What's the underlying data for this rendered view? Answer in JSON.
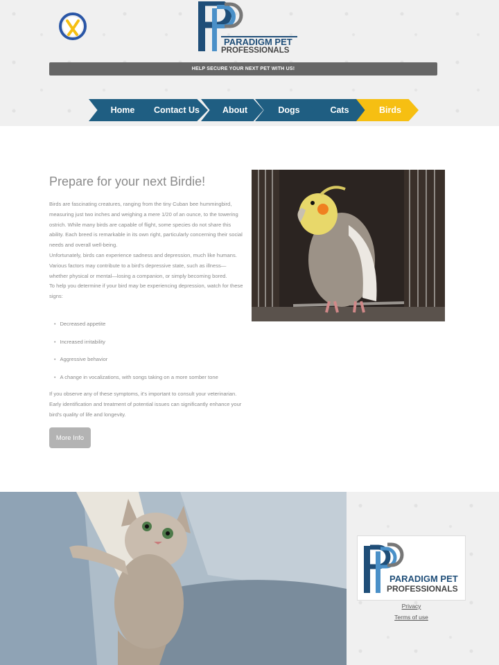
{
  "header": {
    "logo_line1": "PARADIGM PET",
    "logo_line2": "PROFESSIONALS",
    "banner_text": "HELP SECURE YOUR NEXT PET WITH US!",
    "nav": [
      {
        "label": "Home"
      },
      {
        "label": "Contact Us"
      },
      {
        "label": "About"
      },
      {
        "label": "Dogs"
      },
      {
        "label": "Cats"
      },
      {
        "label": "Birds",
        "active": true
      }
    ]
  },
  "main": {
    "heading": "Prepare for your next Birdie!",
    "paragraph1": "Birds are fascinating creatures, ranging from the tiny Cuban bee hummingbird, measuring just two inches and weighing a mere 1/20 of an ounce, to the towering ostrich. While many birds are capable of flight, some species do not share this ability. Each breed is remarkable in its own right, particularly concerning their social needs and overall well-being.",
    "paragraph2": "Unfortunately, birds can experience sadness and depression, much like humans. Various factors may contribute to a bird's depressive state, such as illness—whether physical or mental—losing a companion, or simply becoming bored.",
    "paragraph3": "To help you determine if your bird may be experiencing depression, watch for these signs:",
    "signs": [
      "Decreased appetite",
      "Increased irritability",
      "Aggressive behavior",
      "A change in vocalizations, with songs taking on a more somber tone"
    ],
    "paragraph4": "If you observe any of these symptoms, it's important to consult your veterinarian. Early identification and treatment of potential issues can significantly enhance your bird's quality of life and longevity.",
    "more_button": "More Info"
  },
  "footer": {
    "logo_line1": "PARADIGM PET",
    "logo_line2": "PROFESSIONALS",
    "privacy": "Privacy",
    "terms": "Terms of use"
  },
  "colors": {
    "nav_blue": "#1f5e82",
    "nav_active": "#f6bf12",
    "banner": "#666666",
    "button": "#b3b3b3"
  }
}
